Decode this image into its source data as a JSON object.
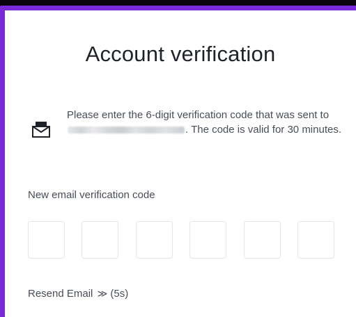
{
  "dialog": {
    "title": "Account verification",
    "message_before": "Please enter the 6-digit verification code that was sent to",
    "message_after": ". The code is valid for 30 minutes.",
    "email_masked": true,
    "icon": "envelope-icon"
  },
  "code_field": {
    "label": "New email verification code",
    "digit_count": 6,
    "values": [
      "",
      "",
      "",
      "",
      "",
      ""
    ]
  },
  "resend": {
    "label": "Resend Email",
    "arrow": "≫",
    "countdown": "(5s)"
  },
  "colors": {
    "frame_border": "#7a2ad9",
    "background": "#0b0510",
    "text_primary": "#1e2329",
    "text_secondary": "#474d57",
    "box_border": "#e3e5e8"
  }
}
